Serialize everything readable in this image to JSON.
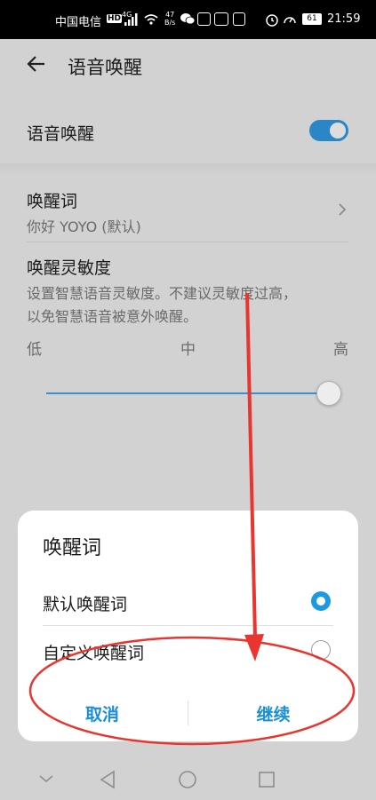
{
  "status_bar": {
    "carrier": "中国电信",
    "hd": "HD",
    "network": "4G",
    "speed_value": "47",
    "speed_unit": "B/s",
    "battery": "61",
    "time": "21:59"
  },
  "header": {
    "title": "语音唤醒"
  },
  "settings": {
    "voice_wakeup_label": "语音唤醒",
    "voice_wakeup_enabled": true,
    "wake_word_label": "唤醒词",
    "wake_word_value": "你好 YOYO (默认)",
    "sensitivity_label": "唤醒灵敏度",
    "sensitivity_desc_line1": "设置智慧语音灵敏度。不建议灵敏度过高，",
    "sensitivity_desc_line2": "以免智慧语音被意外唤醒。",
    "sensitivity_low": "低",
    "sensitivity_mid": "中",
    "sensitivity_high": "高",
    "sensitivity_level_fraction": 1.0
  },
  "dialog": {
    "title": "唤醒词",
    "options": [
      {
        "label": "默认唤醒词",
        "selected": true
      },
      {
        "label": "自定义唤醒词",
        "selected": false
      }
    ],
    "cancel_label": "取消",
    "continue_label": "继续"
  },
  "colors": {
    "accent": "#1b9ae3",
    "annotation": "#e8352f"
  },
  "icons": {
    "back": "back-arrow-icon",
    "chevron": "chevron-right-icon",
    "nav_back": "triangle-back-icon",
    "nav_home": "circle-home-icon",
    "nav_recent": "square-recent-icon"
  }
}
